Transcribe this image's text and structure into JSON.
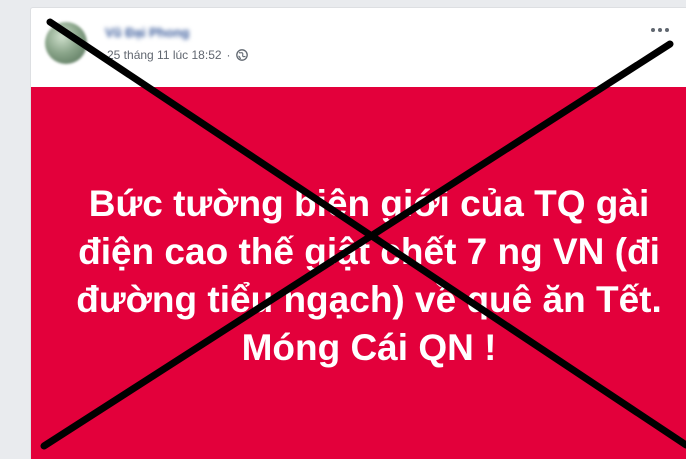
{
  "post": {
    "author_name": "Vũ Đại Phong",
    "timestamp": "25 tháng 11 lúc 18:52",
    "separator": "·",
    "privacy_icon": "globe-icon",
    "more_icon": "more-options-icon",
    "banner_text": "Bức tường biên giới của TQ gài điện cao thế giật chết 7 ng VN (đi đường tiểu ngạch) về quê ăn Tết. Móng Cái QN !",
    "banner_color": "#e3003b",
    "text_color": "#ffffff"
  },
  "overlay": {
    "type": "x-cross",
    "color": "#000000"
  }
}
